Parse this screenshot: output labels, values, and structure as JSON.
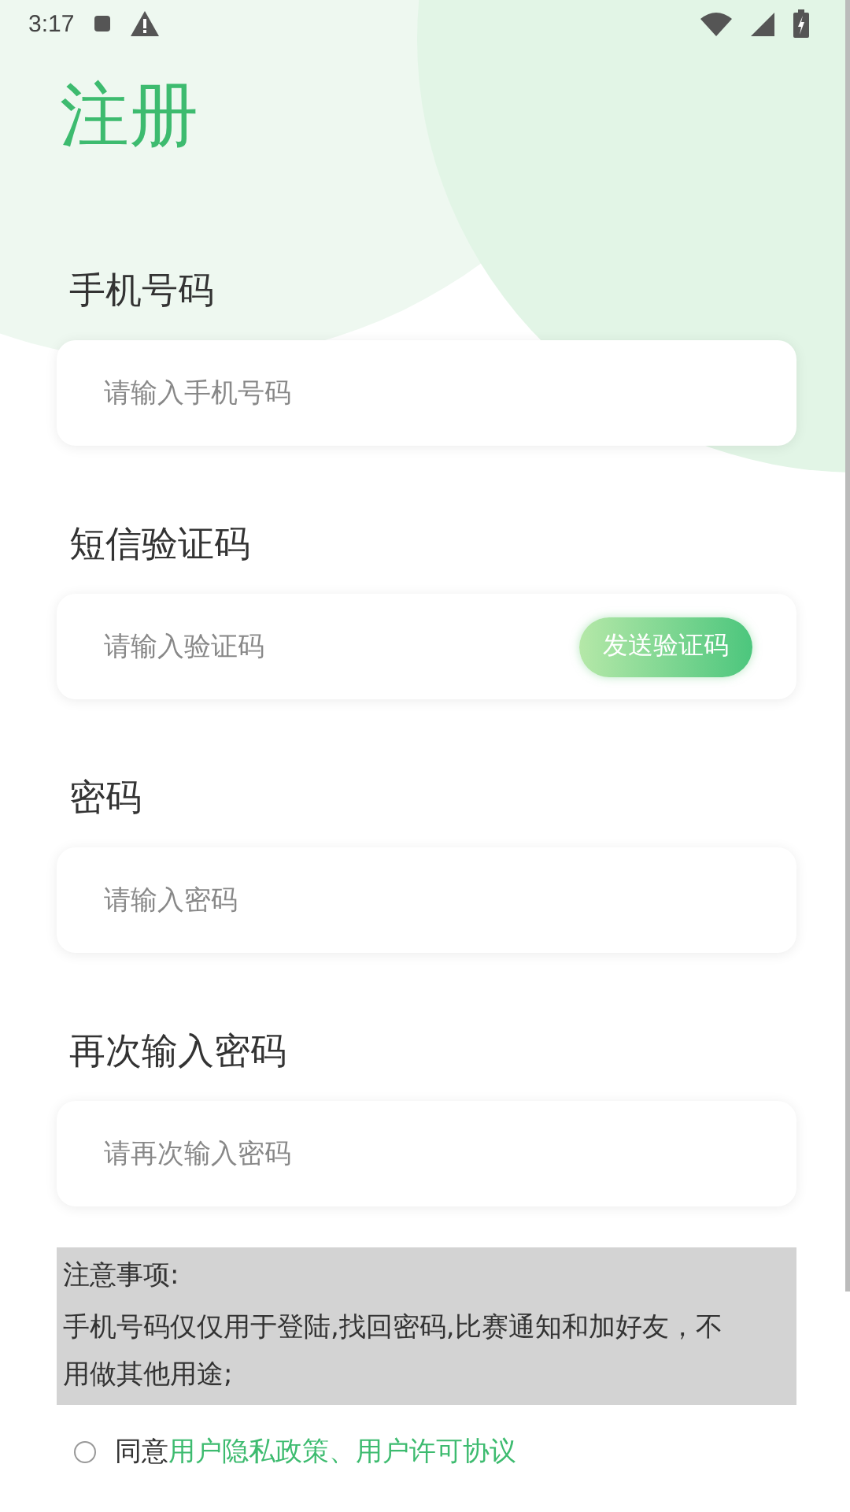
{
  "status_bar": {
    "time": "3:17"
  },
  "title": "注册",
  "fields": [
    {
      "kind": "plain",
      "label": "手机号码",
      "placeholder": "请输入手机号码"
    },
    {
      "kind": "code",
      "label": "短信验证码",
      "placeholder": "请输入验证码",
      "button": "发送验证码"
    },
    {
      "kind": "plain",
      "label": "密码",
      "placeholder": "请输入密码"
    },
    {
      "kind": "plain",
      "label": "再次输入密码",
      "placeholder": "请再次输入密码"
    }
  ],
  "notice": {
    "heading": "注意事项:",
    "body": "手机号码仅仅用于登陆,找回密码,比赛通知和加好友，不用做其他用途;"
  },
  "agreement": {
    "checked": false,
    "prefix": "同意",
    "link": "用户隐私政策、用户许可协议"
  }
}
